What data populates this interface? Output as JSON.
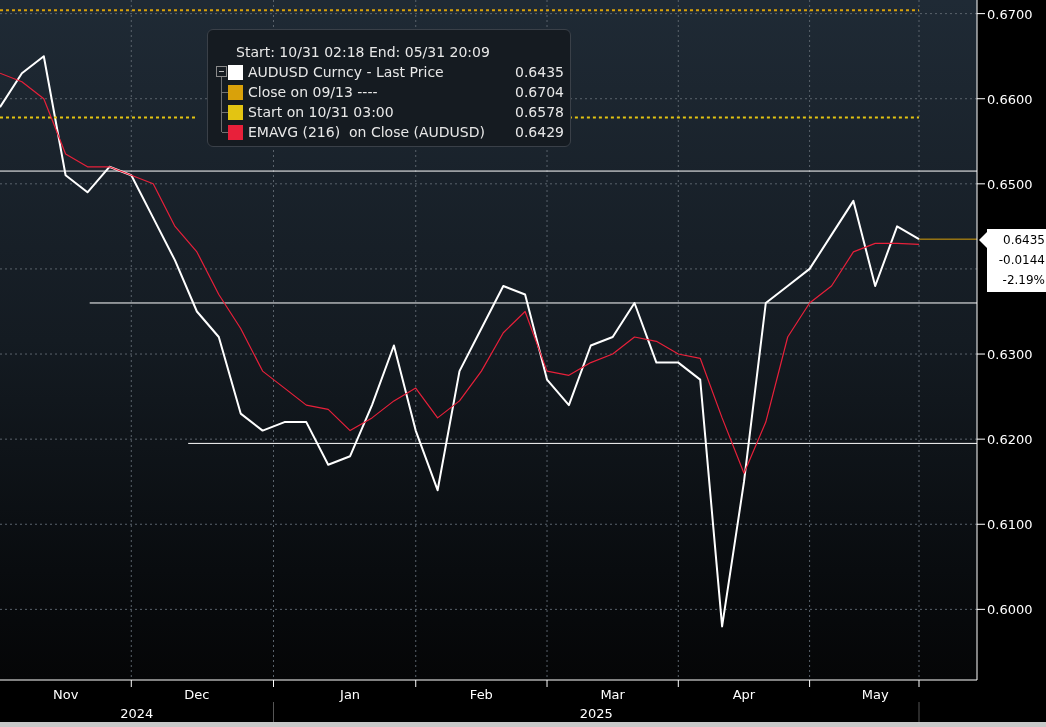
{
  "legend": {
    "header": "Start: 10/31 02:18 End: 05/31 20:09",
    "items": [
      {
        "kind": "series",
        "value": "0.6435"
      },
      {
        "kind": "series",
        "value": "0.6704"
      },
      {
        "kind": "series",
        "value": "0.6578"
      },
      {
        "kind": "series",
        "value": "0.6429"
      }
    ]
  },
  "price_tag": {
    "price": "0.6435",
    "change": "-0.0144",
    "change_pct": "-2.19%"
  },
  "chart_data": {
    "type": "line",
    "grid": true,
    "ylim": [
      0.5917,
      0.6716
    ],
    "categories": [
      null,
      null,
      null,
      "Nov",
      null,
      null,
      null,
      null,
      null,
      "Dec",
      null,
      null,
      null,
      null,
      null,
      null,
      "Jan",
      null,
      null,
      null,
      null,
      null,
      "Feb",
      null,
      null,
      null,
      null,
      null,
      "Mar",
      null,
      null,
      null,
      null,
      null,
      "Apr",
      null,
      null,
      null,
      null,
      null,
      "May",
      null,
      null
    ],
    "series": [
      {
        "name": "AUDUSD Curncy - Last Price",
        "color": "#ffffff",
        "values": [
          0.659,
          0.663,
          0.665,
          0.651,
          0.649,
          0.652,
          0.651,
          0.646,
          0.641,
          0.635,
          0.632,
          0.623,
          0.621,
          0.622,
          0.622,
          0.617,
          0.618,
          0.624,
          0.631,
          0.621,
          0.614,
          0.628,
          0.633,
          0.638,
          0.637,
          0.627,
          0.624,
          0.631,
          0.632,
          0.636,
          0.629,
          0.629,
          0.627,
          0.598,
          0.615,
          0.636,
          0.638,
          0.64,
          0.644,
          0.648,
          0.638,
          0.645,
          0.6435
        ]
      },
      {
        "name": "Close on 09/13 ----",
        "color": "#d9a10a",
        "line_style": "dashed",
        "values": [
          0.6704,
          0.6704,
          0.6704,
          0.6704,
          0.6704,
          0.6704,
          0.6704,
          0.6704,
          0.6704,
          0.6704,
          0.6704,
          0.6704,
          0.6704,
          0.6704,
          0.6704,
          0.6704,
          0.6704,
          0.6704,
          0.6704,
          0.6704,
          0.6704,
          0.6704,
          0.6704,
          0.6704,
          0.6704,
          0.6704,
          0.6704,
          0.6704,
          0.6704,
          0.6704,
          0.6704,
          0.6704,
          0.6704,
          0.6704,
          0.6704,
          0.6704,
          0.6704,
          0.6704,
          0.6704,
          0.6704,
          0.6704,
          0.6704,
          0.6704
        ]
      },
      {
        "name": "Start on 10/31 03:00",
        "color": "#e3c412",
        "line_style": "dashed",
        "values": [
          0.6578,
          0.6578,
          0.6578,
          0.6578,
          0.6578,
          0.6578,
          0.6578,
          0.6578,
          0.6578,
          0.6578,
          null,
          null,
          null,
          null,
          null,
          null,
          null,
          null,
          null,
          null,
          null,
          null,
          null,
          null,
          null,
          null,
          0.6578,
          0.6578,
          0.6578,
          0.6578,
          0.6578,
          0.6578,
          0.6578,
          0.6578,
          0.6578,
          0.6578,
          0.6578,
          0.6578,
          0.6578,
          0.6578,
          0.6578,
          0.6578,
          0.6578
        ]
      },
      {
        "name": "EMAVG (216)  on Close (AUDUSD)",
        "color": "#e8203a",
        "values": [
          0.663,
          0.662,
          0.66,
          0.6535,
          0.652,
          0.652,
          0.651,
          0.65,
          0.645,
          0.642,
          0.637,
          0.633,
          0.628,
          0.626,
          0.624,
          0.6235,
          0.621,
          0.6225,
          0.6245,
          0.626,
          0.6225,
          0.6245,
          0.628,
          0.6325,
          0.635,
          0.628,
          0.6275,
          0.629,
          0.63,
          0.632,
          0.6315,
          0.63,
          0.6295,
          0.6225,
          0.616,
          0.622,
          0.632,
          0.636,
          0.638,
          0.642,
          0.643,
          0.643,
          0.6429
        ]
      }
    ],
    "yticks": [
      {
        "value": 0.67,
        "label": "0.6700"
      },
      {
        "value": 0.66,
        "label": "0.6600"
      },
      {
        "value": 0.65,
        "label": "0.6500"
      },
      {
        "value": 0.63,
        "label": "0.6300"
      },
      {
        "value": 0.62,
        "label": "0.6200"
      },
      {
        "value": 0.61,
        "label": "0.6100"
      },
      {
        "value": 0.6,
        "label": "0.6000"
      }
    ]
  },
  "years": [
    "2024",
    "2025"
  ]
}
